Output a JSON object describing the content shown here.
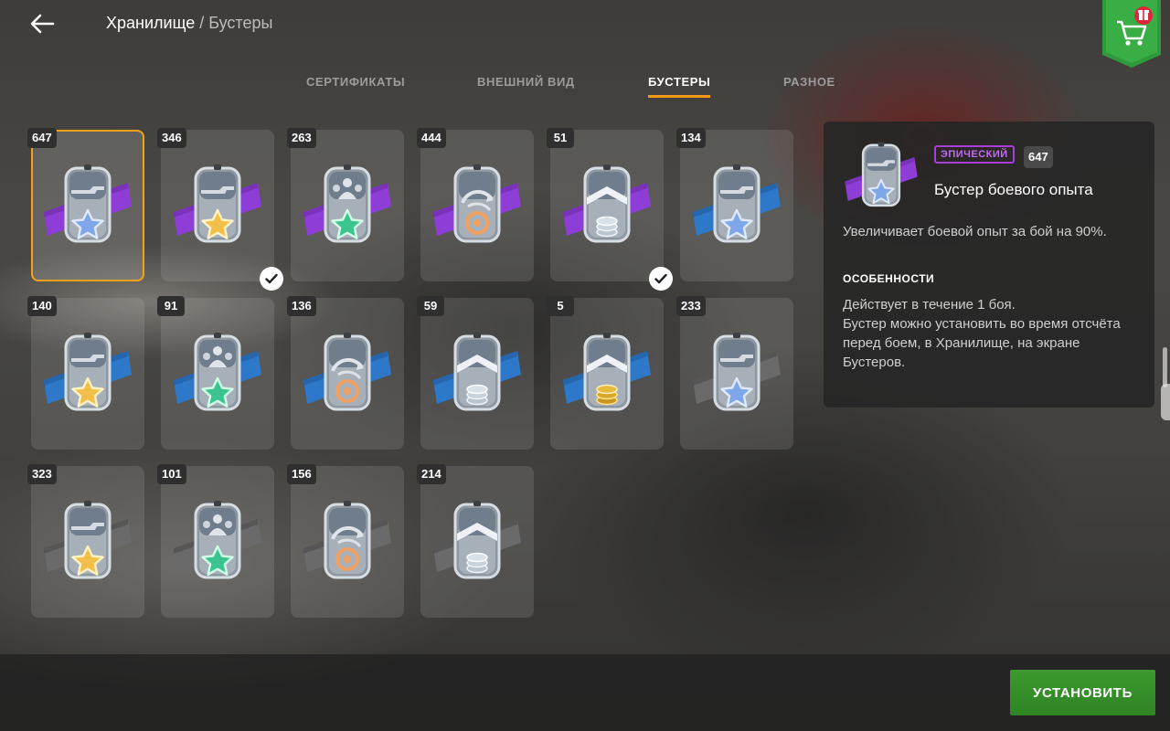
{
  "header": {
    "breadcrumb_root": "Хранилище",
    "breadcrumb_sep": "/",
    "breadcrumb_current": "Бустеры"
  },
  "tabs": [
    {
      "label": "СЕРТИФИКАТЫ",
      "active": false
    },
    {
      "label": "ВНЕШНИЙ ВИД",
      "active": false
    },
    {
      "label": "БУСТЕРЫ",
      "active": true
    },
    {
      "label": "РАЗНОЕ",
      "active": false
    }
  ],
  "colors": {
    "accent": "#f29a14",
    "epic": "#8e3ed6",
    "rare": "#2d78c8",
    "common": "#6a6a6a",
    "install": "#2f8424"
  },
  "boosters": [
    {
      "count": "647",
      "rarity": "epic",
      "icon": "tank-star-icon",
      "emblem": "blue-star",
      "selected": true,
      "equipped": false
    },
    {
      "count": "346",
      "rarity": "epic",
      "icon": "tank-star-icon",
      "emblem": "gold-star",
      "selected": false,
      "equipped": true
    },
    {
      "count": "263",
      "rarity": "epic",
      "icon": "crew-star-icon",
      "emblem": "green-star",
      "selected": false,
      "equipped": false
    },
    {
      "count": "444",
      "rarity": "epic",
      "icon": "refresh-icon",
      "emblem": "orange-refresh",
      "selected": false,
      "equipped": false
    },
    {
      "count": "51",
      "rarity": "epic",
      "icon": "coins-icon",
      "emblem": "silver-coins",
      "selected": false,
      "equipped": true
    },
    {
      "count": "134",
      "rarity": "rare",
      "icon": "tank-star-icon",
      "emblem": "blue-star",
      "selected": false,
      "equipped": false
    },
    {
      "count": "140",
      "rarity": "rare",
      "icon": "tank-star-icon",
      "emblem": "gold-star",
      "selected": false,
      "equipped": false
    },
    {
      "count": "91",
      "rarity": "rare",
      "icon": "crew-star-icon",
      "emblem": "green-star",
      "selected": false,
      "equipped": false
    },
    {
      "count": "136",
      "rarity": "rare",
      "icon": "refresh-icon",
      "emblem": "orange-refresh",
      "selected": false,
      "equipped": false
    },
    {
      "count": "59",
      "rarity": "rare",
      "icon": "coins-icon",
      "emblem": "silver-coins",
      "selected": false,
      "equipped": false
    },
    {
      "count": "5",
      "rarity": "rare",
      "icon": "coins-icon",
      "emblem": "gold-coins",
      "selected": false,
      "equipped": false
    },
    {
      "count": "233",
      "rarity": "common",
      "icon": "tank-star-icon",
      "emblem": "blue-star",
      "selected": false,
      "equipped": false
    },
    {
      "count": "323",
      "rarity": "common",
      "icon": "tank-star-icon",
      "emblem": "gold-star",
      "selected": false,
      "equipped": false
    },
    {
      "count": "101",
      "rarity": "common",
      "icon": "crew-star-icon",
      "emblem": "green-star",
      "selected": false,
      "equipped": false
    },
    {
      "count": "156",
      "rarity": "common",
      "icon": "refresh-icon",
      "emblem": "orange-refresh",
      "selected": false,
      "equipped": false
    },
    {
      "count": "214",
      "rarity": "common",
      "icon": "coins-icon",
      "emblem": "silver-coins",
      "selected": false,
      "equipped": false
    }
  ],
  "detail": {
    "rarity_label": "ЭПИЧЕСКИЙ",
    "count": "647",
    "name": "Бустер боевого опыта",
    "description": "Увеличивает боевой опыт за бой на 90%.",
    "features_title": "ОСОБЕННОСТИ",
    "features_line1": "Действует в течение 1 боя.",
    "features_line2": "Бустер можно установить во время отсчёта перед боем, в Хранилище, на экране Бустеров."
  },
  "actions": {
    "install_label": "УСТАНОВИТЬ"
  }
}
